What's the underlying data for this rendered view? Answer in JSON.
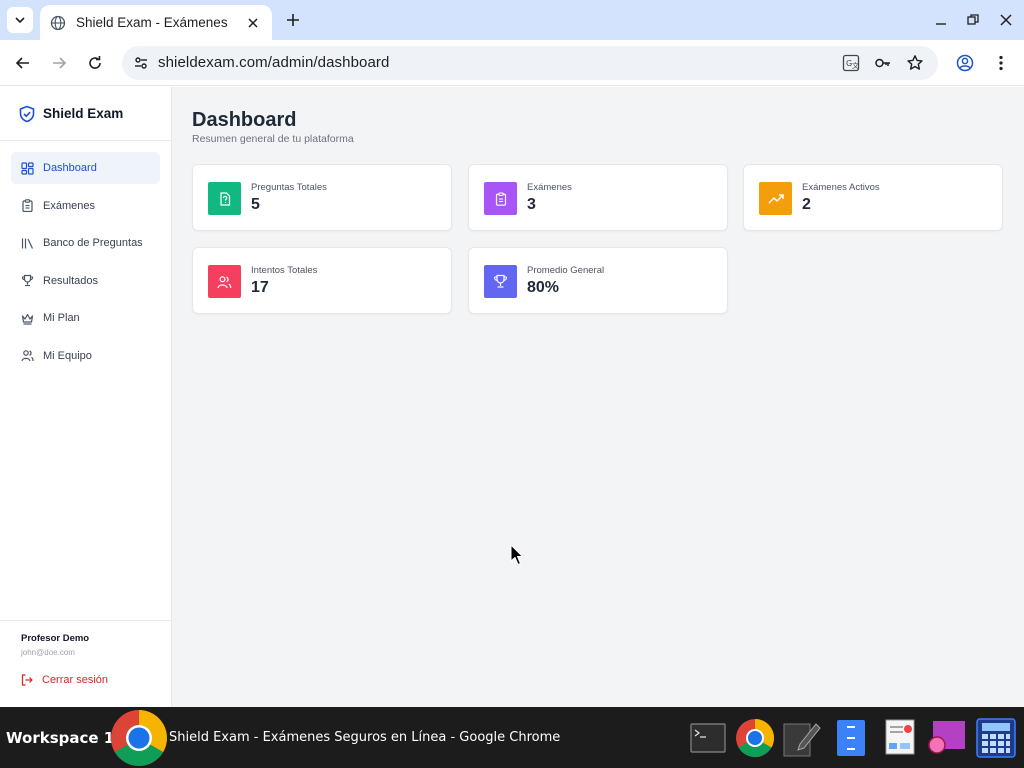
{
  "browser": {
    "tab_title": "Shield Exam - Exámenes",
    "url": "shieldexam.com/admin/dashboard"
  },
  "sidebar": {
    "brand": "Shield Exam",
    "items": [
      {
        "label": "Dashboard",
        "icon": "grid-icon",
        "active": true
      },
      {
        "label": "Exámenes",
        "icon": "clipboard-icon",
        "active": false
      },
      {
        "label": "Banco de Preguntas",
        "icon": "library-icon",
        "active": false
      },
      {
        "label": "Resultados",
        "icon": "trophy-icon",
        "active": false
      },
      {
        "label": "Mi Plan",
        "icon": "crown-icon",
        "active": false
      },
      {
        "label": "Mi Equipo",
        "icon": "users-icon",
        "active": false
      }
    ],
    "user_name": "Profesor Demo",
    "user_email": "john@doe.com",
    "logout_label": "Cerrar sesión"
  },
  "main": {
    "title": "Dashboard",
    "subtitle": "Resumen general de tu plataforma",
    "stats": [
      {
        "label": "Preguntas Totales",
        "value": "5",
        "color": "#10b981",
        "icon": "question-file-icon"
      },
      {
        "label": "Exámenes",
        "value": "3",
        "color": "#a855f7",
        "icon": "clipboard-icon"
      },
      {
        "label": "Exámenes Activos",
        "value": "2",
        "color": "#f59e0b",
        "icon": "trending-up-icon"
      },
      {
        "label": "Intentos Totales",
        "value": "17",
        "color": "#f43f5e",
        "icon": "users-icon"
      },
      {
        "label": "Promedio General",
        "value": "80%",
        "color": "#6366f1",
        "icon": "trophy-icon"
      }
    ]
  },
  "taskbar": {
    "workspace": "Workspace 1",
    "window_title": "Shield Exam - Exámenes Seguros en Línea - Google Chrome"
  },
  "colors": {
    "accent": "#1d4ed8",
    "tabstrip": "#d3e3fd",
    "logout": "#dc2626"
  }
}
